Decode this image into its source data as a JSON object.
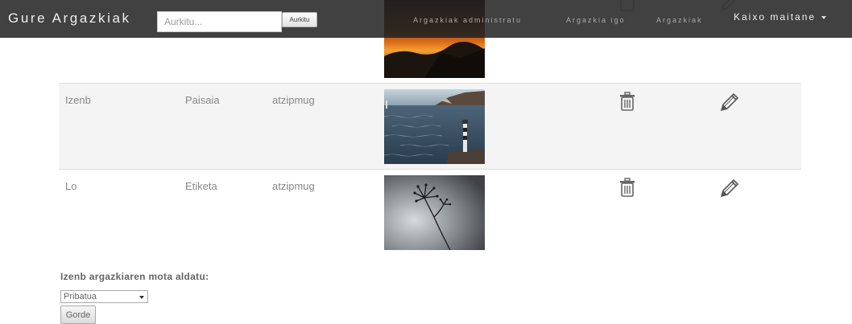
{
  "navbar": {
    "brand": "Gure Argazkiak",
    "search_placeholder": "Aurkitu...",
    "search_button": "Aurkitu",
    "links": [
      "Argazkiak administratu",
      "Argazkia igo",
      "Argazkiak"
    ],
    "user_menu": "Kaixo maitane"
  },
  "table": {
    "rows": [
      {
        "name": "Izenb",
        "type": "Paisaia",
        "user": "atzipmug",
        "thumbnail": "lighthouse-sea-photo"
      },
      {
        "name": "Lo",
        "type": "Etiketa",
        "user": "atzipmug",
        "thumbnail": "dry-plant-silhouette-photo"
      }
    ],
    "partial_row_thumbnail": "sunset-photo",
    "delete_icon": "trash-icon",
    "edit_icon": "pencil-icon"
  },
  "form": {
    "label": "Izenb argazkiaren mota aldatu:",
    "select_value": "Pribatua",
    "save_button": "Gorde"
  },
  "colors": {
    "navbar_bg": "#222222",
    "row_alt_bg": "#f4f4f4",
    "text": "#777777"
  }
}
